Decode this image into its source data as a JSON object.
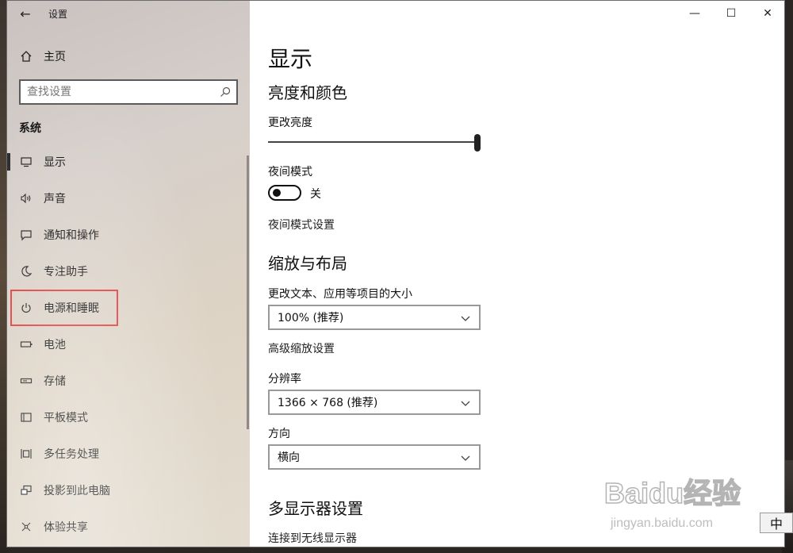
{
  "window": {
    "title": "设置",
    "controls": {
      "minimize": "—",
      "maximize": "☐",
      "close": "✕"
    }
  },
  "sidebar": {
    "back_label": "←",
    "home_label": "主页",
    "search_placeholder": "查找设置",
    "section_title": "系统",
    "items": [
      {
        "label": "显示",
        "icon": "monitor-icon",
        "active": true
      },
      {
        "label": "声音",
        "icon": "speaker-icon"
      },
      {
        "label": "通知和操作",
        "icon": "notification-icon"
      },
      {
        "label": "专注助手",
        "icon": "moon-icon"
      },
      {
        "label": "电源和睡眠",
        "icon": "power-icon",
        "highlighted": true
      },
      {
        "label": "电池",
        "icon": "battery-icon"
      },
      {
        "label": "存储",
        "icon": "storage-icon"
      },
      {
        "label": "平板模式",
        "icon": "tablet-icon"
      },
      {
        "label": "多任务处理",
        "icon": "multitask-icon"
      },
      {
        "label": "投影到此电脑",
        "icon": "project-icon"
      },
      {
        "label": "体验共享",
        "icon": "share-icon"
      }
    ]
  },
  "main": {
    "page_title": "显示",
    "brightness_section": {
      "title": "亮度和颜色",
      "brightness_label": "更改亮度",
      "brightness_value": 1.0,
      "night_mode_label": "夜间模式",
      "night_mode_state": "关",
      "night_mode_settings_link": "夜间模式设置"
    },
    "scale_section": {
      "title": "缩放与布局",
      "text_size_label": "更改文本、应用等项目的大小",
      "text_size_value": "100% (推荐)",
      "advanced_scaling_link": "高级缩放设置",
      "resolution_label": "分辨率",
      "resolution_value": "1366 × 768 (推荐)",
      "orientation_label": "方向",
      "orientation_value": "横向"
    },
    "multi_display_section": {
      "title": "多显示器设置",
      "wireless_link": "连接到无线显示器"
    }
  },
  "overlay": {
    "watermark_text": "Baidu经验",
    "watermark_url": "jingyan.baidu.com",
    "ime_label": "中"
  }
}
